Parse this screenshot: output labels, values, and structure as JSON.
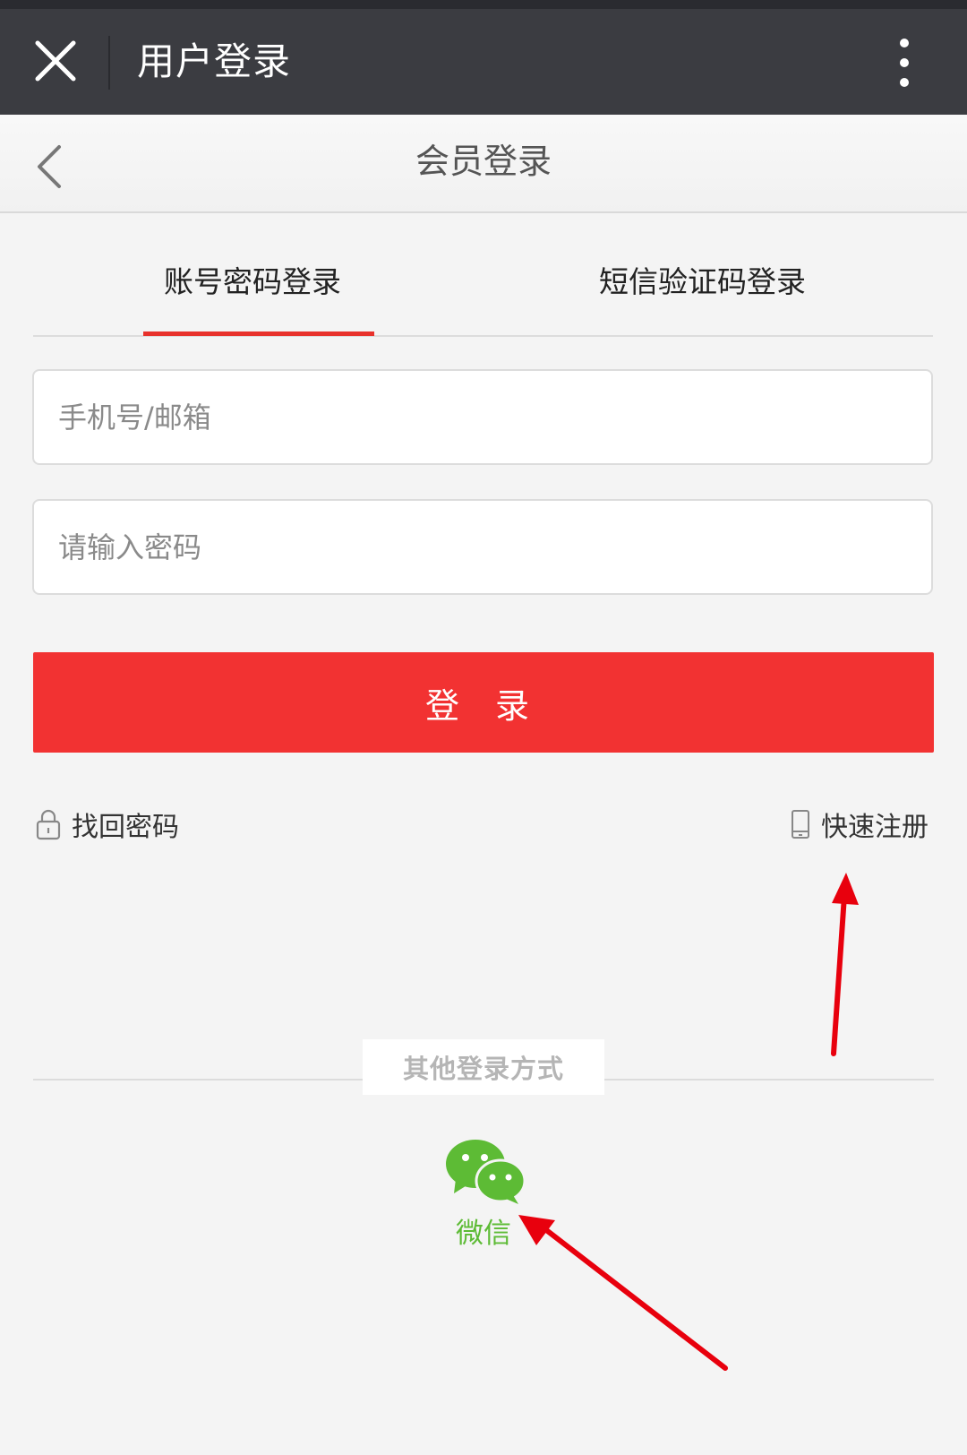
{
  "window": {
    "title": "用户登录",
    "close_icon": "close-icon",
    "more_icon": "more-vertical-icon"
  },
  "nav": {
    "title": "会员登录",
    "back_icon": "chevron-left-icon"
  },
  "tabs": [
    {
      "label": "账号密码登录",
      "active": true
    },
    {
      "label": "短信验证码登录",
      "active": false
    }
  ],
  "form": {
    "account_placeholder": "手机号/邮箱",
    "account_value": "",
    "password_placeholder": "请输入密码",
    "password_value": "",
    "login_label": "登 录"
  },
  "links": {
    "forgot_label": "找回密码",
    "forgot_icon": "lock-icon",
    "register_label": "快速注册",
    "register_icon": "mobile-phone-icon"
  },
  "other_login": {
    "heading": "其他登录方式",
    "providers": [
      {
        "label": "微信",
        "icon": "wechat-icon"
      }
    ]
  },
  "colors": {
    "titlebar": "#3b3c41",
    "accent_red": "#f23232",
    "wechat_green": "#5dbb35",
    "annotation_arrow": "#e8000d"
  }
}
